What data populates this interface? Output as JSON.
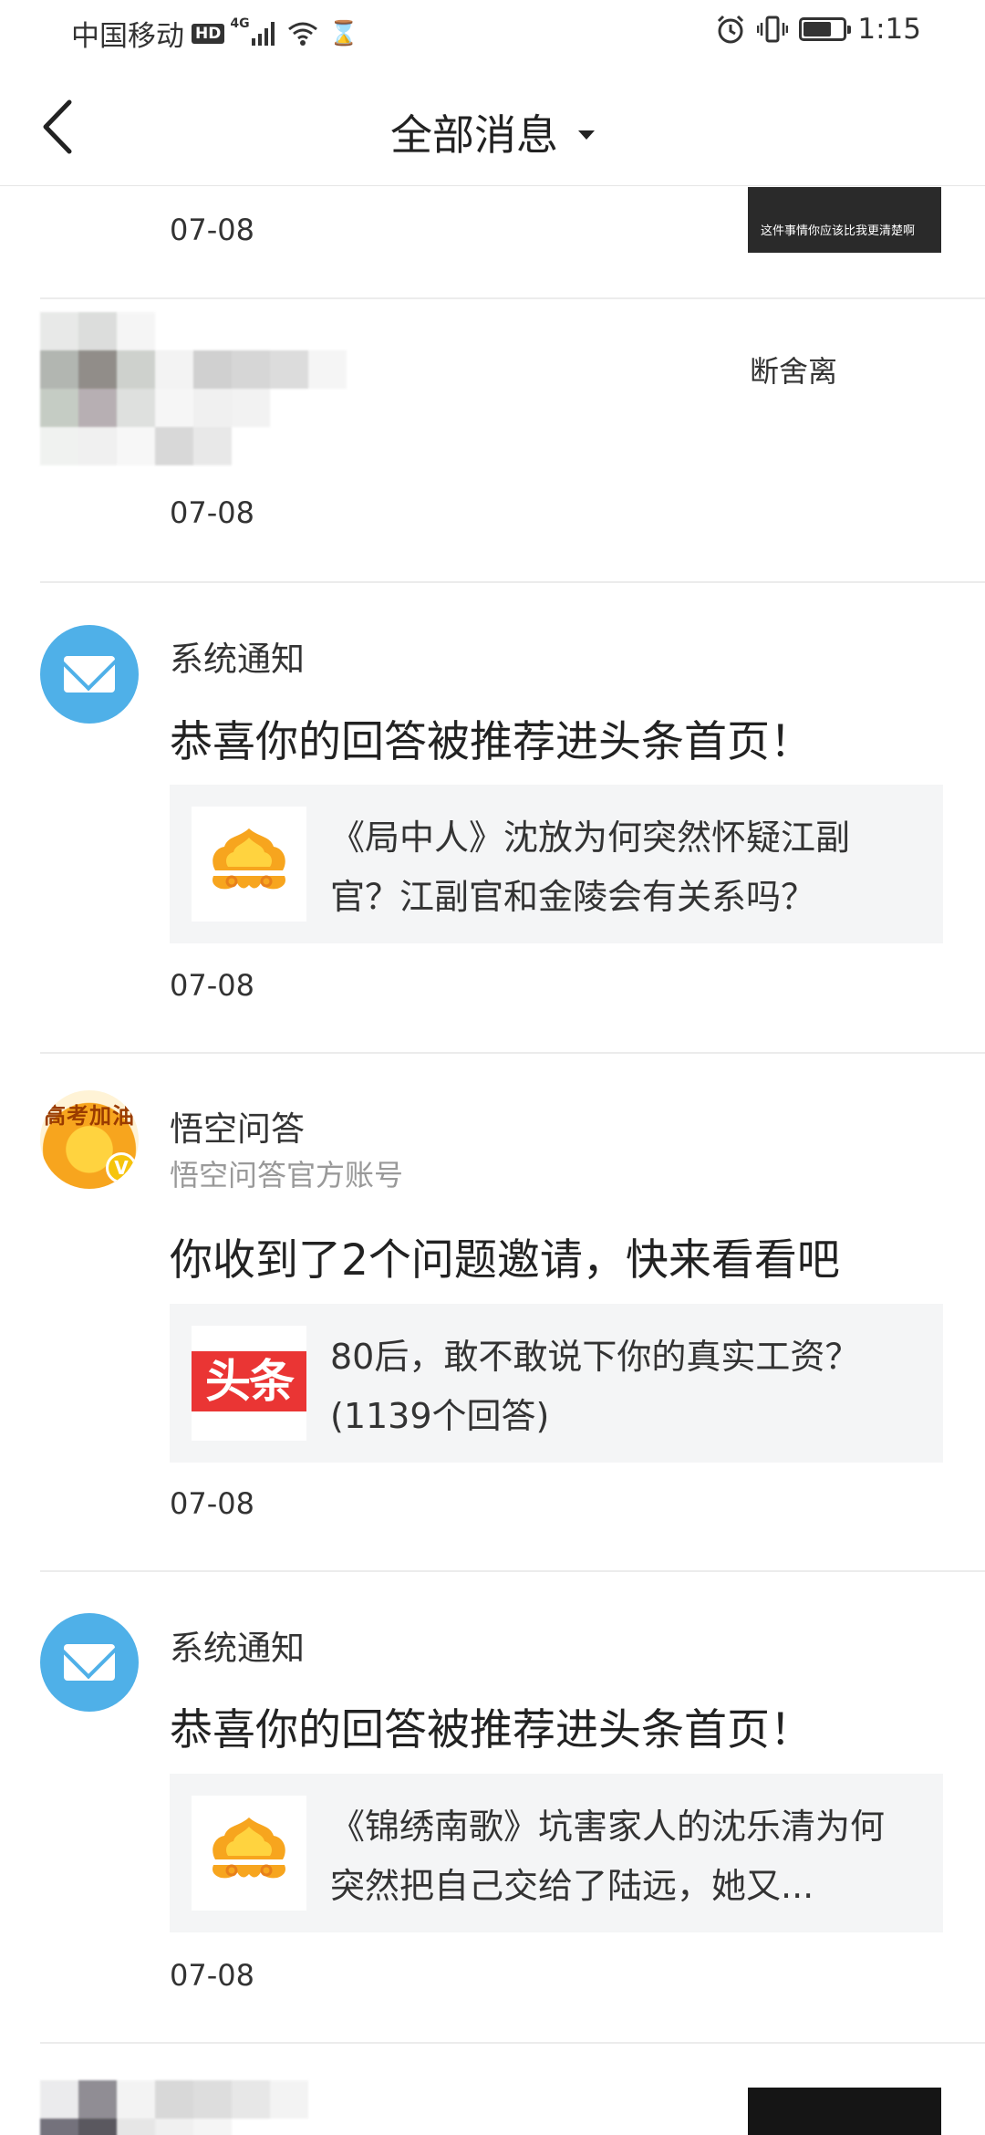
{
  "status_bar": {
    "carrier": "中国移动",
    "hd": "HD",
    "network": "4G",
    "time": "1:15",
    "battery_level": 0.7
  },
  "header": {
    "title": "全部消息"
  },
  "items": [
    {
      "date": "07-08",
      "thumb_caption": "这件事情你应该比我更清楚啊"
    },
    {
      "side_text": "断舍离",
      "date": "07-08"
    },
    {
      "sender": "系统通知",
      "message": "恭喜你的回答被推荐进头条首页！",
      "card_text": "《局中人》沈放为何突然怀疑江副官？江副官和金陵会有关系吗？",
      "date": "07-08"
    },
    {
      "sender": "悟空问答",
      "avatar_banner": "高考加油",
      "subtitle": "悟空问答官方账号",
      "message": "你收到了2个问题邀请，快来看看吧",
      "card_logo": "头条",
      "card_text": "80后，敢不敢说下你的真实工资？(1139个回答)",
      "date": "07-08"
    },
    {
      "sender": "系统通知",
      "message": "恭喜你的回答被推荐进头条首页！",
      "card_text": "《锦绣南歌》坑害家人的沈乐清为何突然把自己交给了陆远，她又...",
      "date": "07-08"
    }
  ],
  "colors": {
    "accent_blue": "#4fb0e8",
    "card_bg": "#f4f5f6",
    "divider": "#ececec",
    "toutiao_red": "#ea3534"
  }
}
